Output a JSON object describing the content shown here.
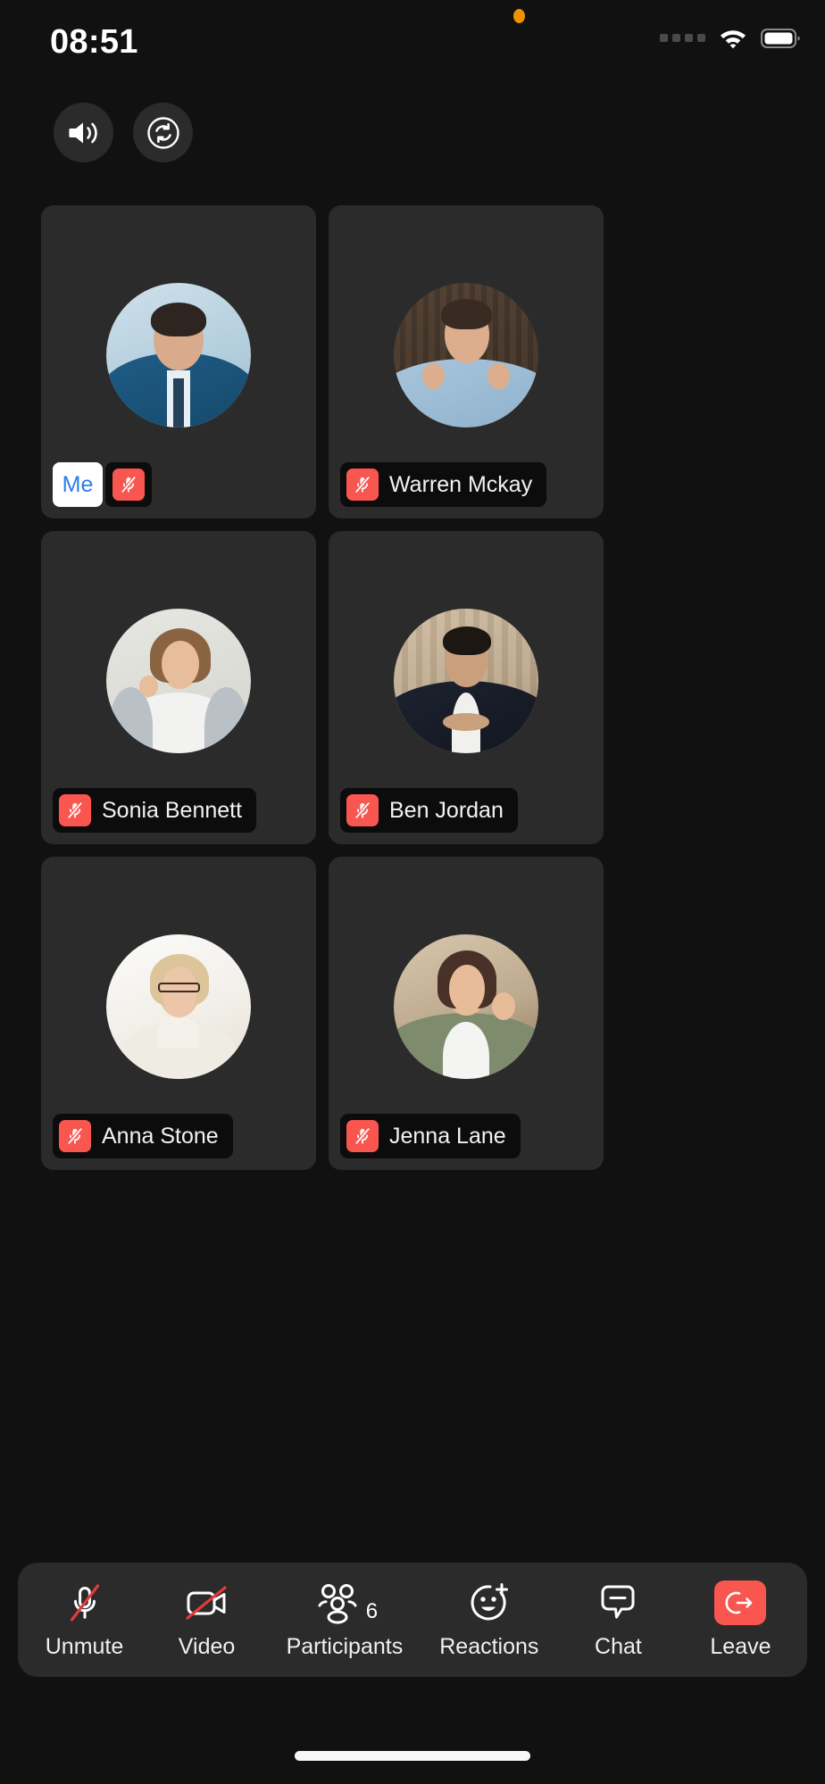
{
  "status_bar": {
    "time": "08:51",
    "privacy_indicator": "orange-dot-icon",
    "signal_icon": "signal-dots-icon",
    "wifi_icon": "wifi-icon",
    "battery_icon": "battery-icon"
  },
  "top_controls": [
    {
      "name": "speaker-button",
      "icon": "speaker-icon"
    },
    {
      "name": "switch-camera-button",
      "icon": "camera-flip-icon"
    }
  ],
  "colors": {
    "background": "#111111",
    "tile": "#2b2b2b",
    "accent_red": "#f9564f",
    "me_blue": "#2a7fe8",
    "label_bg": "#0c0c0c",
    "privacy_orange": "#f09200"
  },
  "participants": [
    {
      "label": "Me",
      "is_me": true,
      "muted": true,
      "mic_icon": "mic-muted-icon",
      "avatar": "man-in-blue-suit"
    },
    {
      "label": "Warren Mckay",
      "is_me": false,
      "muted": true,
      "mic_icon": "mic-muted-icon",
      "avatar": "man-with-glasses-hands-raised"
    },
    {
      "label": "Sonia Bennett",
      "is_me": false,
      "muted": true,
      "mic_icon": "mic-muted-icon",
      "avatar": "woman-grey-cardigan"
    },
    {
      "label": "Ben Jordan",
      "is_me": false,
      "muted": true,
      "mic_icon": "mic-muted-icon",
      "avatar": "man-dark-blazer"
    },
    {
      "label": "Anna Stone",
      "is_me": false,
      "muted": true,
      "mic_icon": "mic-muted-icon",
      "avatar": "blonde-woman-glasses"
    },
    {
      "label": "Jenna Lane",
      "is_me": false,
      "muted": true,
      "mic_icon": "mic-muted-icon",
      "avatar": "woman-green-cardigan-waving"
    }
  ],
  "toolbar": [
    {
      "label": "Unmute",
      "icon": "mic-off-icon",
      "badge": ""
    },
    {
      "label": "Video",
      "icon": "video-off-icon",
      "badge": ""
    },
    {
      "label": "Participants",
      "icon": "participants-icon",
      "badge": "6"
    },
    {
      "label": "Reactions",
      "icon": "reactions-icon",
      "badge": ""
    },
    {
      "label": "Chat",
      "icon": "chat-icon",
      "badge": ""
    },
    {
      "label": "Leave",
      "icon": "leave-icon",
      "badge": ""
    }
  ],
  "home_indicator": "home-indicator"
}
